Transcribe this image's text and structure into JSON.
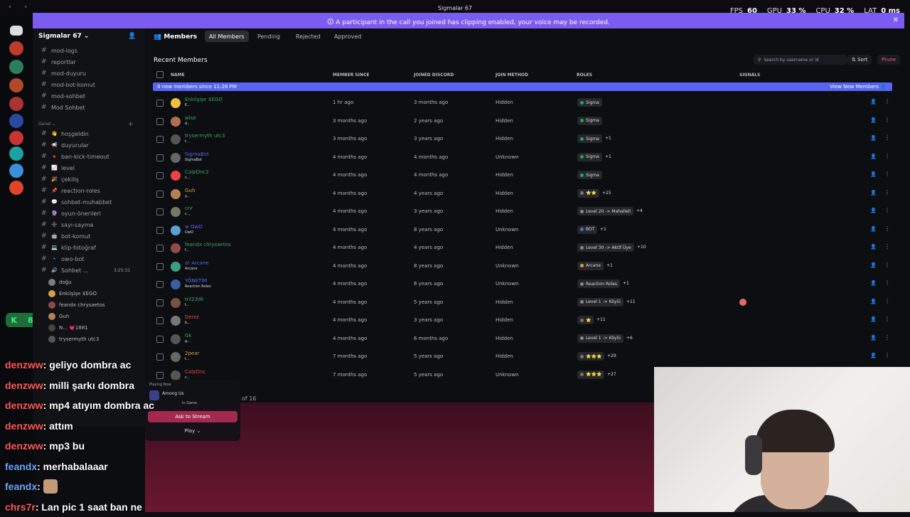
{
  "window": {
    "title": "Sigmalar 67",
    "fps_label": "FPS",
    "fps": "60",
    "gpu_label": "GPU",
    "gpu": "33 %",
    "cpu_label": "CPU",
    "cpu": "32 %",
    "lat_label": "LAT",
    "lat": "0 ms",
    "nav": "‹ ›"
  },
  "notice": {
    "text": "A participant in the call you joined has clipping enabled, your voice may be recorded.",
    "close": "✕"
  },
  "counter": {
    "left": "K",
    "right": "8"
  },
  "server": {
    "name": "Sigmalar 67 ⌄"
  },
  "channels_top": [
    {
      "name": "mod-logs"
    },
    {
      "name": "reportlar"
    },
    {
      "name": "mod-duyuru"
    },
    {
      "name": "mod-bot-komut"
    },
    {
      "name": "mod-sohbet"
    },
    {
      "name": "Mod Sohbet"
    }
  ],
  "category": "Genel ⌄",
  "channels_genel": [
    {
      "emoji": "👋",
      "name": "hoşgeldin"
    },
    {
      "emoji": "📢",
      "name": "duyurular"
    },
    {
      "emoji": "🔺",
      "name": "ban-kick-timeout"
    },
    {
      "emoji": "📈",
      "name": "level"
    },
    {
      "emoji": "🎉",
      "name": "çekiliş"
    },
    {
      "emoji": "📌",
      "name": "reaction-roles"
    },
    {
      "emoji": "💬",
      "name": "sohbet-muhabbet"
    },
    {
      "emoji": "🔮",
      "name": "oyun-önerileri"
    },
    {
      "emoji": "➕",
      "name": "sayı-sayma"
    },
    {
      "emoji": "🤖",
      "name": "bot-komut"
    },
    {
      "emoji": "💻",
      "name": "klip-fotoğraf"
    },
    {
      "emoji": "🔹",
      "name": "owo-bot"
    },
    {
      "emoji": "🔊",
      "name": "Sohbet ..."
    }
  ],
  "voice_timer": "3:25:31",
  "voice_users": [
    {
      "name": "doğu",
      "color": "#7d7f86"
    },
    {
      "name": "Enkiişişe ⊻EGO",
      "color": "#d4a14a"
    },
    {
      "name": "feandx chrysaetos",
      "color": "#8f4a4a"
    },
    {
      "name": "Guh",
      "color": "#b48250"
    },
    {
      "name": "N... 💗1881",
      "color": "#444"
    },
    {
      "name": "trysermyth utc3",
      "color": "#555"
    }
  ],
  "toolbar": {
    "heading": "Members",
    "tabs": [
      "All Members",
      "Pending",
      "Rejected",
      "Approved"
    ]
  },
  "main": {
    "recent": "Recent Members",
    "search_placeholder": "Search by username or id",
    "sort": "⇅ Sort",
    "prune": "Prune"
  },
  "columns": [
    "NAME",
    "MEMBER SINCE",
    "JOINED DISCORD",
    "JOIN METHOD",
    "ROLES",
    "SIGNALS"
  ],
  "banner": {
    "text": "4 new members since 11:26 PM",
    "action": "View New Members 👤"
  },
  "members": [
    {
      "name": "Enkiişişe ⊻EGO",
      "sub": "E...",
      "color": "#3ba55c",
      "av": "#f0c040",
      "since": "1 hr ago",
      "joined": "3 months ago",
      "method": "Hidden",
      "role": "Sigma",
      "rc": "#23a55a",
      "more": ""
    },
    {
      "name": "wise",
      "sub": "d...",
      "color": "#3ba55c",
      "av": "#b07050",
      "since": "3 months ago",
      "joined": "2 years ago",
      "method": "Hidden",
      "role": "Sigma",
      "rc": "#23a55a",
      "more": ""
    },
    {
      "name": "trysermyth utc3",
      "sub": "t...",
      "color": "#3ba55c",
      "av": "#555",
      "since": "3 months ago",
      "joined": "3 years ago",
      "method": "Hidden",
      "role": "Sigma",
      "rc": "#23a55a",
      "more": "+1"
    },
    {
      "name": "SigmaBot",
      "sub": "SigmaBot",
      "color": "#5865f2",
      "av": "#666",
      "since": "4 months ago",
      "joined": "4 months ago",
      "method": "Unknown",
      "role": "Sigma",
      "rc": "#23a55a",
      "more": "+1"
    },
    {
      "name": "CalpDnc2",
      "sub": "c...",
      "color": "#3ba55c",
      "av": "#ed4245",
      "since": "4 months ago",
      "joined": "4 months ago",
      "method": "Hidden",
      "role": "Sigma",
      "rc": "#23a55a",
      "more": ""
    },
    {
      "name": "Guh",
      "sub": "y...",
      "color": "#d4a14a",
      "av": "#b48250",
      "since": "4 months ago",
      "joined": "4 years ago",
      "method": "Hidden",
      "role": "⭐⭐",
      "rc": "#777",
      "more": "+25"
    },
    {
      "name": "cnr",
      "sub": "c...",
      "color": "#3ba55c",
      "av": "#776",
      "since": "4 months ago",
      "joined": "3 years ago",
      "method": "Hidden",
      "role": "Level 20 -> Mahalleli",
      "rc": "#888",
      "more": "+4"
    },
    {
      "name": "w OwO",
      "sub": "OwO",
      "color": "#5865f2",
      "av": "#5aa0d0",
      "since": "4 months ago",
      "joined": "8 years ago",
      "method": "Unknown",
      "role": "BOT",
      "rc": "#3a7bd5",
      "more": "+1"
    },
    {
      "name": "feandx chrysaetos",
      "sub": "f...",
      "color": "#3ba55c",
      "av": "#8f4a4a",
      "since": "4 months ago",
      "joined": "4 years ago",
      "method": "Hidden",
      "role": "Level 30 -> Aktif Üye",
      "rc": "#888",
      "more": "+10"
    },
    {
      "name": "a! Arcane",
      "sub": "Arcane",
      "color": "#5865f2",
      "av": "#3aa080",
      "since": "4 months ago",
      "joined": "8 years ago",
      "method": "Unknown",
      "role": "Arcane",
      "rc": "#e0a030",
      "more": "+1"
    },
    {
      "name": "YÖNETİM",
      "sub": "Reaction Roles",
      "color": "#5865f2",
      "av": "#3a5fa0",
      "since": "4 months ago",
      "joined": "6 years ago",
      "method": "Unknown",
      "role": "Reaction Roles",
      "rc": "#888",
      "more": "+1"
    },
    {
      "name": "tnl23dk",
      "sub": "t...",
      "color": "#3ba55c",
      "av": "#7a5040",
      "since": "4 months ago",
      "joined": "5 years ago",
      "method": "Hidden",
      "role": "Level 1 -> Köylü",
      "rc": "#888",
      "more": "+11"
    },
    {
      "name": "Deniz",
      "sub": "b...",
      "color": "#ed4245",
      "av": "#777",
      "since": "4 months ago",
      "joined": "3 years ago",
      "method": "Hidden",
      "role": "⭐",
      "rc": "#777",
      "more": "+11"
    },
    {
      "name": "Gk",
      "sub": "g...",
      "color": "#3ba55c",
      "av": "#555",
      "since": "4 months ago",
      "joined": "6 months ago",
      "method": "Hidden",
      "role": "Level 1 -> Köylü",
      "rc": "#888",
      "more": "+6"
    },
    {
      "name": "2pear",
      "sub": "t...",
      "color": "#d4a14a",
      "av": "#666",
      "since": "7 months ago",
      "joined": "5 years ago",
      "method": "Hidden",
      "role": "⭐⭐⭐",
      "rc": "#777",
      "more": "+29"
    },
    {
      "name": "CalpDnc",
      "sub": "c...",
      "color": "#ed4245",
      "av": "#555",
      "since": "7 months ago",
      "joined": "5 years ago",
      "method": "Unknown",
      "role": "⭐⭐⭐",
      "rc": "#777",
      "more": "+27"
    }
  ],
  "pagination": "of 16",
  "activity": {
    "label": "Playing Now",
    "game": "Among Us",
    "status": "In Game",
    "ask": "Ask to Stream",
    "play": "Play ⌄"
  },
  "chat": [
    {
      "user": "denzww",
      "msg": ": geliyo dombra ac",
      "blue": false
    },
    {
      "user": "denzww",
      "msg": ": milli şarkı dombra",
      "blue": false
    },
    {
      "user": "denzww",
      "msg": ": mp4 atıyım dombra ac",
      "blue": false
    },
    {
      "user": "denzww",
      "msg": ": attım",
      "blue": false
    },
    {
      "user": "denzww",
      "msg": ": mp3 bu",
      "blue": false
    },
    {
      "user": "feandx",
      "msg": ": merhabalaaar",
      "blue": true
    },
    {
      "user": "feandx",
      "msg": ":",
      "blue": true,
      "emote": true
    },
    {
      "user": "chrs7r",
      "msg": ": Lan pic 1 saat ban ne",
      "blue": false
    }
  ]
}
